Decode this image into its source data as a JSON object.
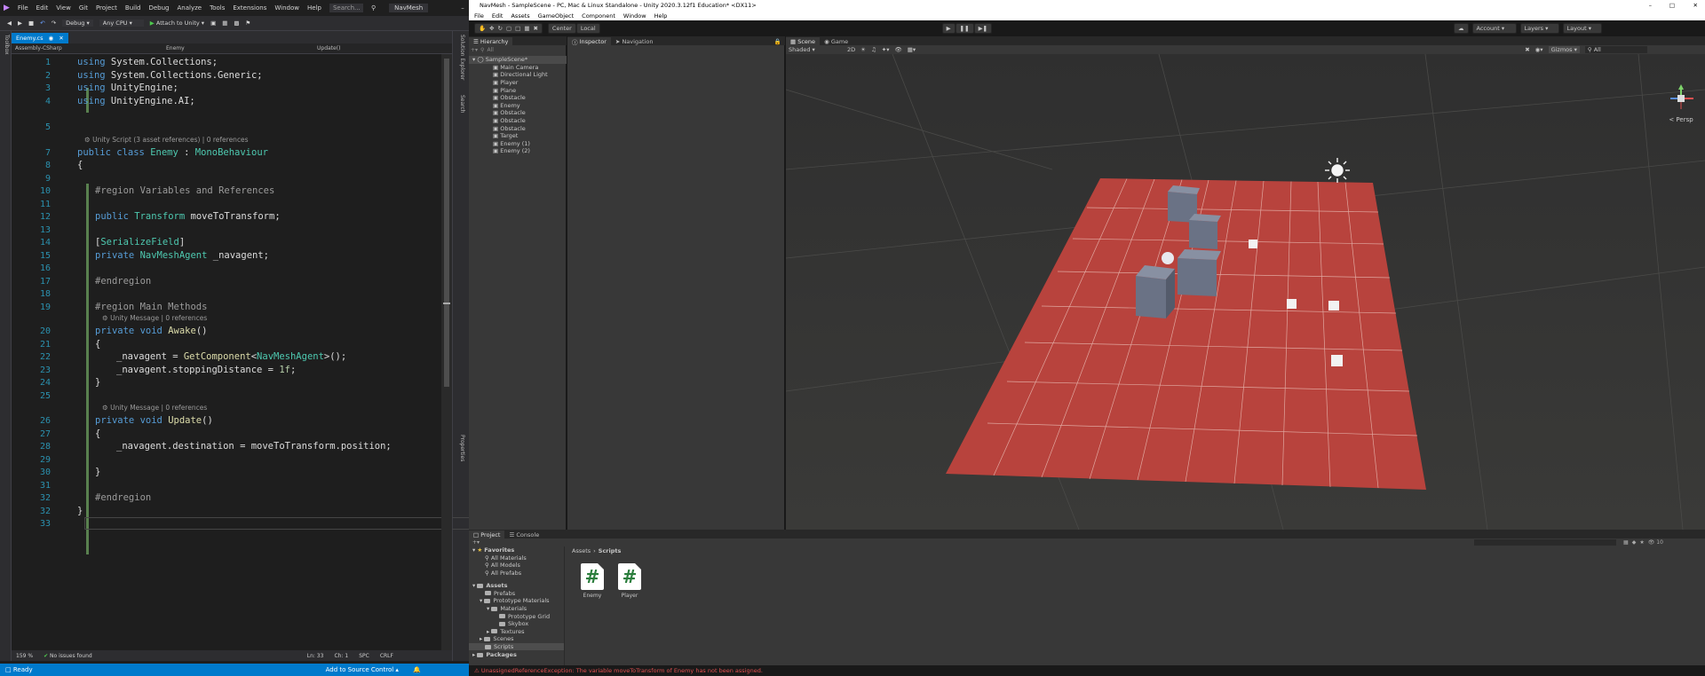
{
  "vs": {
    "menu": [
      "File",
      "Edit",
      "View",
      "Git",
      "Project",
      "Build",
      "Debug",
      "Analyze",
      "Tools",
      "Extensions",
      "Window",
      "Help"
    ],
    "search_label": "Search...",
    "solution_name": "NavMesh",
    "toolbar": {
      "config": "Debug",
      "platform": "Any CPU",
      "attach": "Attach to Unity"
    },
    "tab": {
      "name": "Enemy.cs"
    },
    "nav": {
      "project": "Assembly-CSharp",
      "class": "Enemy",
      "member": "Update()"
    },
    "side_left": "Toolbox",
    "side_right": [
      "Solution Explorer",
      "Search",
      "Properties"
    ],
    "lens_script": "Unity Script (3 asset references) | 0 references",
    "lens_message": "Unity Message | 0 references",
    "status": {
      "zoom": "159 %",
      "issues": "No issues found",
      "ln": "Ln: 33",
      "ch": "Ch: 1",
      "spc": "SPC",
      "crlf": "CRLF"
    },
    "bottom": {
      "ready": "Ready",
      "source": "Add to Source Control"
    }
  },
  "code": {
    "l1": [
      "using",
      " System.Collections;"
    ],
    "l2": [
      "using",
      " System.Collections.Generic;"
    ],
    "l3": [
      "using",
      " UnityEngine;"
    ],
    "l4": [
      "using",
      " UnityEngine.AI;"
    ],
    "l7": [
      "public",
      " class ",
      "Enemy",
      " : ",
      "MonoBehaviour"
    ],
    "l8": "{",
    "l10": "#region Variables and References",
    "l12": [
      "public ",
      "Transform",
      " moveToTransform;"
    ],
    "l14": [
      "[",
      "SerializeField",
      "]"
    ],
    "l15": [
      "private ",
      "NavMeshAgent",
      " _navagent;"
    ],
    "l17": "#endregion",
    "l19": "#region Main Methods",
    "l20": [
      "private",
      " void ",
      "Awake",
      "()"
    ],
    "l21": "{",
    "l22": [
      "_navagent = ",
      "GetComponent",
      "<",
      "NavMeshAgent",
      ">();"
    ],
    "l23": [
      "_navagent.stoppingDistance = ",
      "1f",
      ";"
    ],
    "l24": "}",
    "l26": [
      "private",
      " void ",
      "Update",
      "()"
    ],
    "l27": "{",
    "l28": "_navagent.destination = moveToTransform.position;",
    "l30": "}",
    "l31": "#endregion",
    "l32": "}",
    "line_numbers": [
      "1",
      "2",
      "3",
      "4",
      "5",
      "7",
      "8",
      "9",
      "10",
      "11",
      "12",
      "13",
      "14",
      "15",
      "16",
      "17",
      "18",
      "19",
      "20",
      "21",
      "22",
      "23",
      "24",
      "25",
      "26",
      "27",
      "28",
      "29",
      "30",
      "31",
      "32",
      "33"
    ]
  },
  "unity": {
    "title": "NavMesh - SampleScene - PC, Mac & Linux Standalone - Unity 2020.3.12f1 Education* <DX11>",
    "menu": [
      "File",
      "Edit",
      "Assets",
      "GameObject",
      "Component",
      "Window",
      "Help"
    ],
    "toolbar": {
      "center": "Center",
      "local": "Local",
      "account": "Account",
      "layers": "Layers",
      "layout": "Layout"
    },
    "hierarchy": {
      "tab": "Hierarchy",
      "search": "All",
      "scene": "SampleScene*",
      "items": [
        "Main Camera",
        "Directional Light",
        "Player",
        "Plane",
        "Obstacle",
        "Enemy",
        "Obstacle",
        "Obstacle",
        "Obstacle",
        "Target",
        "Enemy (1)",
        "Enemy (2)"
      ]
    },
    "inspector_tab": "Inspector",
    "navigation_tab": "Navigation",
    "scene_tab": "Scene",
    "game_tab": "Game",
    "scene_toolbar": {
      "shading": "Shaded",
      "mode": "2D",
      "gizmos": "Gizmos",
      "search": "All"
    },
    "gizmo_label": "< Persp",
    "project": {
      "tab": "Project",
      "console_tab": "Console",
      "favorites": "Favorites",
      "fav_items": [
        "All Materials",
        "All Models",
        "All Prefabs"
      ],
      "assets": "Assets",
      "tree": [
        "Prefabs",
        "Prototype Materials",
        "Materials",
        "Prototype Grid",
        "Skybox",
        "Textures",
        "Scenes",
        "Scripts"
      ],
      "packages": "Packages",
      "breadcrumb": [
        "Assets",
        "Scripts"
      ],
      "files": [
        "Enemy",
        "Player"
      ],
      "count": "10"
    },
    "error": "UnassignedReferenceException: The variable moveToTransform of Enemy has not been assigned."
  },
  "colors": {
    "vs_accent": "#007acc",
    "grid_red": "#b8433d",
    "error": "#e05050"
  }
}
